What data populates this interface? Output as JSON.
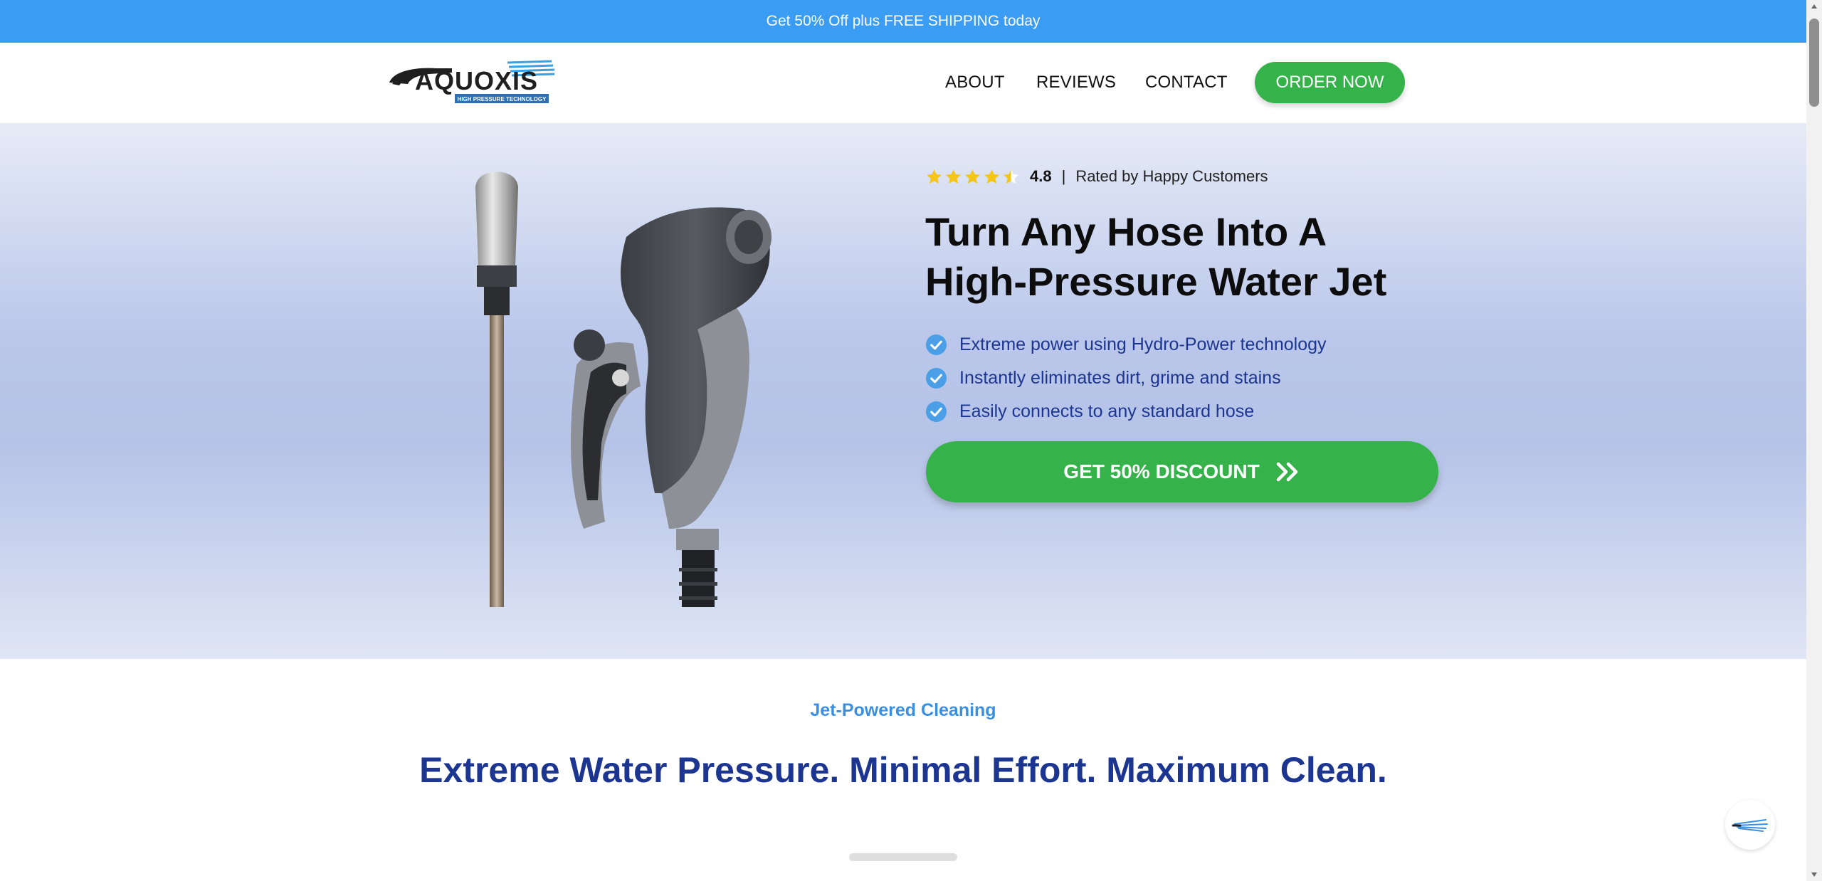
{
  "promo": {
    "text": "Get 50% Off plus FREE SHIPPING today"
  },
  "header": {
    "logo_text": "AQUOXIS",
    "logo_tagline": "HIGH PRESSURE TECHNOLOGY",
    "nav": {
      "about": "ABOUT",
      "reviews": "REVIEWS",
      "contact": "CONTACT"
    },
    "order_label": "ORDER NOW"
  },
  "hero": {
    "rating": {
      "value": "4.8",
      "separator": "|",
      "text": "Rated by Happy Customers",
      "stars": 4.5
    },
    "title_line1": "Turn Any Hose Into A",
    "title_line2": "High-Pressure Water Jet",
    "features": [
      "Extreme power using Hydro-Power technology",
      "Instantly eliminates dirt, grime and stains",
      "Easily connects to any standard hose"
    ],
    "cta_label": "GET 50% DISCOUNT",
    "cta_icon": "double-chevron-right-icon"
  },
  "section": {
    "eyebrow": "Jet-Powered Cleaning",
    "title": "Extreme Water Pressure. Minimal Effort. Maximum Clean."
  },
  "colors": {
    "promo_bg": "#3a9cf3",
    "cta_green": "#36b24a",
    "heading_blue": "#1c3591",
    "eyebrow_blue": "#3a8fe0",
    "star_yellow": "#f5c518",
    "check_blue": "#4a9fe6"
  }
}
